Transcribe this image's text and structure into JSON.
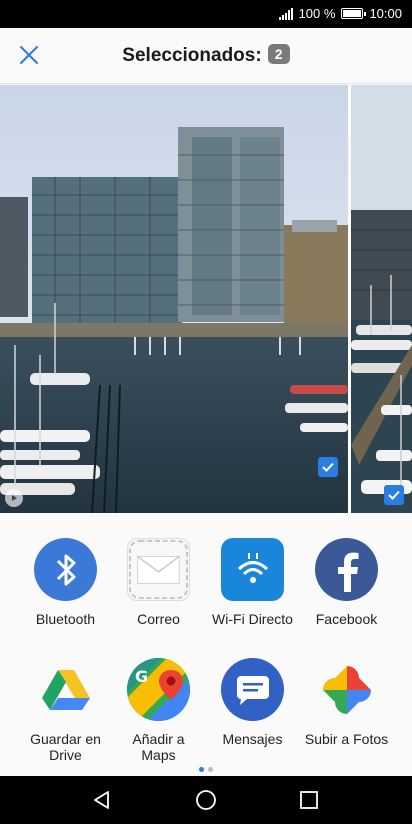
{
  "status": {
    "battery_text": "100 %",
    "battery_level": 1.0,
    "time": "10:00"
  },
  "header": {
    "title": "Seleccionados:",
    "count": "2",
    "close_icon": "close-icon"
  },
  "gallery": {
    "photos": [
      {
        "selected": true,
        "has_video_badge": true
      },
      {
        "selected": true,
        "has_video_badge": false
      }
    ]
  },
  "share": {
    "apps": [
      {
        "label": "Bluetooth",
        "icon": "bluetooth-icon"
      },
      {
        "label": "Correo",
        "icon": "mail-icon"
      },
      {
        "label": "Wi-Fi Directo",
        "icon": "wifi-direct-icon"
      },
      {
        "label": "Facebook",
        "icon": "facebook-icon"
      },
      {
        "label": "Guardar en Drive",
        "icon": "google-drive-icon"
      },
      {
        "label": "Añadir a Maps",
        "icon": "google-maps-icon"
      },
      {
        "label": "Mensajes",
        "icon": "messages-icon"
      },
      {
        "label": "Subir a Fotos",
        "icon": "google-photos-icon"
      }
    ],
    "page_count": 2,
    "active_page": 1
  },
  "colors": {
    "accent": "#2a7de1",
    "bluetooth": "#3b78d8",
    "facebook": "#3b5998",
    "messages": "#3161c4"
  }
}
